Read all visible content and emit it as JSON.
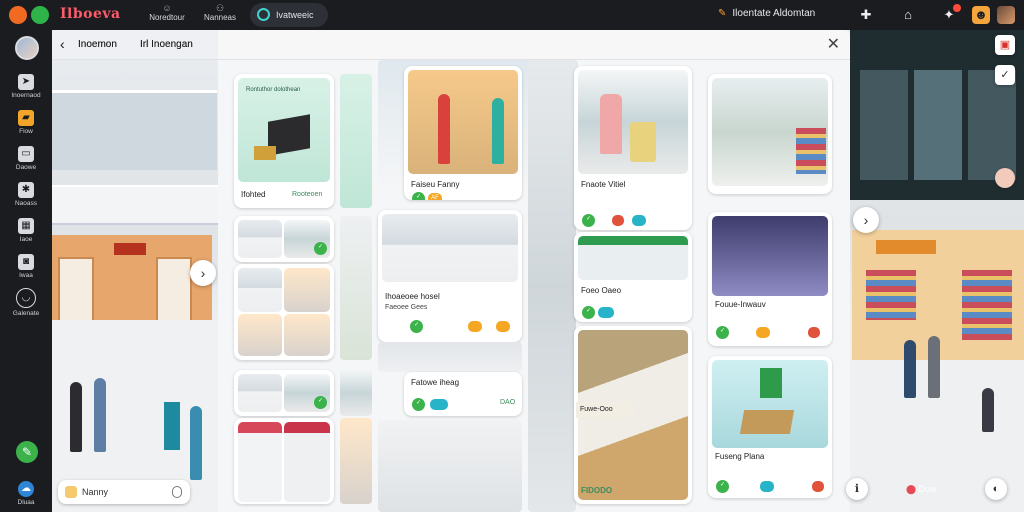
{
  "topbar": {
    "brand": "Ilboeva",
    "tabs": [
      {
        "icon": "person-icon",
        "label": "Noredtour"
      },
      {
        "icon": "people-icon",
        "label": "Nanneas"
      }
    ],
    "search_label": "Ivatweeic",
    "title": "Iloentate Aldomtan"
  },
  "rail": {
    "items": [
      {
        "icon": "share-icon",
        "label": "Inoernaod"
      },
      {
        "icon": "folder-icon",
        "label": "Fiow"
      },
      {
        "icon": "window-icon",
        "label": "Daowe"
      },
      {
        "icon": "settings-icon",
        "label": "Naoass"
      },
      {
        "icon": "keyboard-icon",
        "label": "Iaoe"
      },
      {
        "icon": "camera-icon",
        "label": "Iwaa"
      },
      {
        "icon": "power-icon",
        "label": "Galenate"
      }
    ],
    "bottom_label": "Dluaa"
  },
  "panel": {
    "back_label": "Inoemon",
    "title": "Irl Inoengan"
  },
  "left_search": {
    "placeholder": "Nanny"
  },
  "cards": {
    "c1": {
      "caption": "Ifohted",
      "meta": "Rooteoen",
      "header": "Rontuthor dolothean"
    },
    "c2": {
      "caption": "Faiseu Fanny",
      "chip_label": "AF"
    },
    "c3": {
      "caption": "Fnaote Vitiel"
    },
    "c4": {
      "caption": "Ihoaeoee hosel",
      "sub": "Faeoee Gees"
    },
    "c5": {
      "caption": "Foeo Oaeo"
    },
    "c6": {
      "caption": "Fouue-Inwauv"
    },
    "c7": {
      "caption": "Fatowe iheag",
      "chip_label": "DAO"
    },
    "c8": {
      "caption": "Fuseng Plana"
    },
    "c9": {
      "caption": "Fuwe-Ooo",
      "tag": "FIDODO"
    }
  },
  "right": {
    "location_label": "Duw"
  }
}
